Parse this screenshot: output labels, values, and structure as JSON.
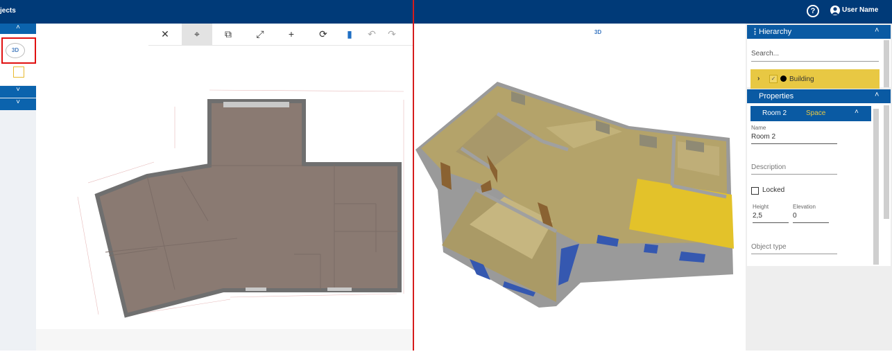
{
  "header": {
    "title": "jects",
    "help_icon": "help-circle-icon",
    "user_name": "User Name"
  },
  "left_sidebar": {
    "chevron_up": "˄",
    "chevron_down_1": "˅",
    "chevron_down_2": "˅",
    "toggle_3d_label": "3D"
  },
  "toolbar": {
    "items": [
      "fit",
      "target",
      "crop",
      "expand",
      "add",
      "rotate",
      "delete",
      "undo",
      "redo"
    ]
  },
  "view3d": {
    "rotate_label": "3D"
  },
  "right_panel": {
    "hierarchy_title": "Hierarchy",
    "search_placeholder": "Search...",
    "building_label": "Building",
    "properties_title": "Properties",
    "room_title": "Room 2",
    "room_type": "Space",
    "name_label": "Name",
    "name_value": "Room 2",
    "description_placeholder": "Description",
    "locked_label": "Locked",
    "height_label": "Height",
    "height_value": "2,5",
    "elevation_label": "Elevation",
    "elevation_value": "0",
    "object_type_placeholder": "Object type"
  },
  "colors": {
    "header_bg": "#003a78",
    "accent_blue": "#0a5aa3",
    "highlight_yellow": "#e8c843",
    "divider_red": "#d61c1c",
    "selected_room": "#e3c22a"
  }
}
